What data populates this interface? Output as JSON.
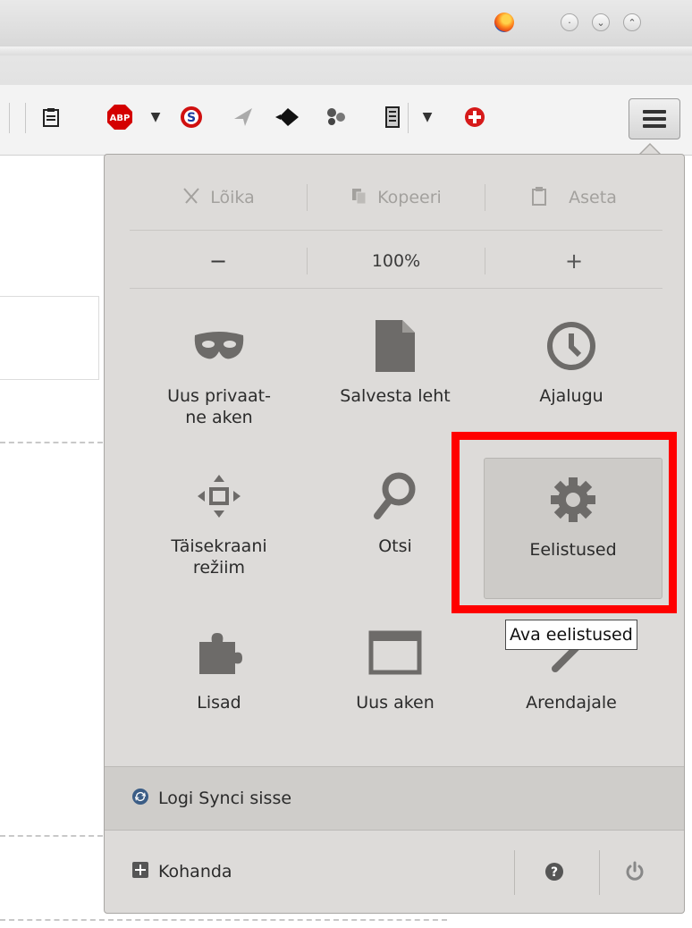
{
  "window": {
    "controls": [
      "minimize",
      "maximize",
      "close"
    ]
  },
  "toolbar": {
    "icons": [
      "clipboard-list-icon",
      "adblock-plus-icon",
      "dropdown-arrow-icon",
      "red-s-icon",
      "send-arrow-icon",
      "bird-icon",
      "bubbles-icon",
      "battery-icon",
      "red-cross-icon"
    ],
    "abp_label": "ABP"
  },
  "menu": {
    "edit": {
      "cut": "Lõika",
      "copy": "Kopeeri",
      "paste": "Aseta"
    },
    "zoom": {
      "minus": "−",
      "level": "100%",
      "plus": "+"
    },
    "items": [
      {
        "label": "Uus privaat-\nne aken",
        "icon": "mask-icon"
      },
      {
        "label": "Salvesta leht",
        "icon": "page-icon"
      },
      {
        "label": "Ajalugu",
        "icon": "clock-icon"
      },
      {
        "label": "Täisekraani\nrežiim",
        "icon": "fullscreen-icon"
      },
      {
        "label": "Otsi",
        "icon": "search-icon"
      },
      {
        "label": "Eelistused",
        "icon": "gear-icon",
        "highlighted": true
      },
      {
        "label": "Lisad",
        "icon": "puzzle-icon"
      },
      {
        "label": "Uus aken",
        "icon": "window-icon"
      },
      {
        "label": "Arendajale",
        "icon": "wrench-icon"
      }
    ],
    "tooltip": "Ava eelistused",
    "sync_label": "Logi Synci sisse",
    "customize_label": "Kohanda"
  },
  "colors": {
    "highlight": "#ff0000",
    "panel_bg": "#dddbd9"
  }
}
